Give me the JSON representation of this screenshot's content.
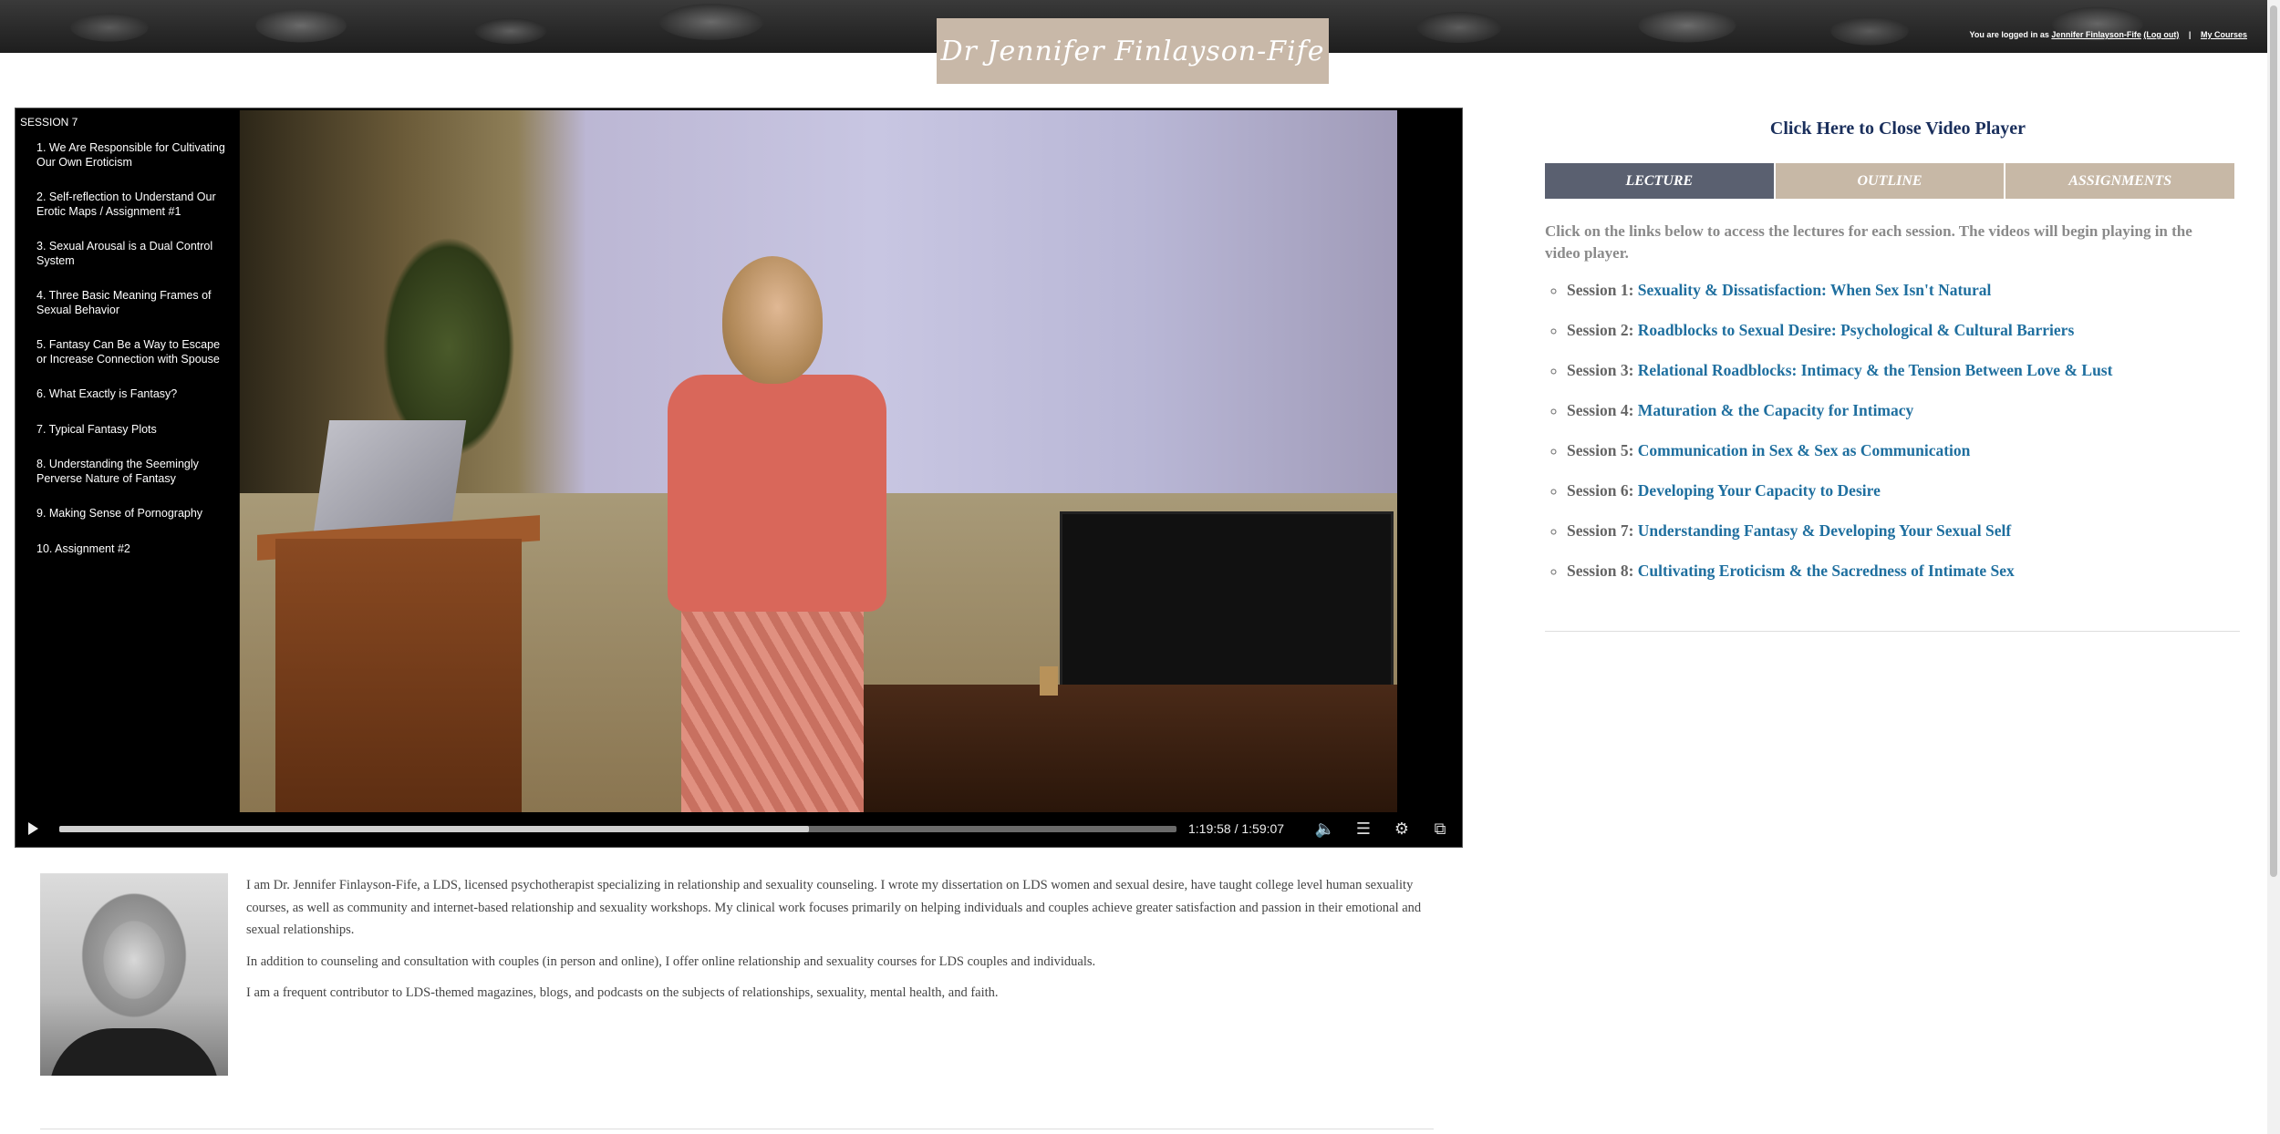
{
  "header": {
    "logo_text": "Dr Jennifer Finlayson-Fife",
    "login_prefix": "You are logged in as",
    "user_name": "Jennifer Finlayson-Fife",
    "logout_label": "(Log out)",
    "separator": "|",
    "my_courses_label": "My Courses"
  },
  "player": {
    "session_label": "SESSION 7",
    "chapters": [
      "1. We Are Responsible for Cultivating Our Own Eroticism",
      "2. Self-reflection to Understand Our Erotic Maps / Assignment #1",
      "3. Sexual Arousal is a Dual Control System",
      "4. Three Basic Meaning Frames of Sexual Behavior",
      "5. Fantasy Can Be a Way to Escape or Increase Connection with Spouse",
      "6. What Exactly is Fantasy?",
      "7. Typical Fantasy Plots",
      "8. Understanding the Seemingly Perverse Nature of Fantasy",
      "9. Making Sense of Pornography",
      "10. Assignment #2"
    ],
    "time_display": "1:19:58 / 1:59:07",
    "progress_fraction": 0.671
  },
  "bio": {
    "paragraphs": [
      "I am Dr. Jennifer Finlayson-Fife, a LDS, licensed psychotherapist specializing in relationship and sexuality counseling. I wrote my dissertation on LDS women and sexual desire, have taught college level human sexuality courses, as well as community and internet-based relationship and sexuality workshops. My clinical work focuses primarily on helping individuals and couples achieve greater satisfaction and passion in their emotional and sexual relationships.",
      "In addition to counseling and consultation with couples (in person and online), I offer online relationship and sexuality courses for LDS couples and individuals.",
      "I am a frequent contributor to LDS-themed magazines, blogs, and podcasts on the subjects of relationships, sexuality, mental health, and faith."
    ]
  },
  "panel": {
    "close_link": "Click Here to Close Video Player",
    "tabs": [
      "LECTURE",
      "OUTLINE",
      "ASSIGNMENTS"
    ],
    "active_tab": "LECTURE",
    "intro": "Click on the links below to access the lectures for each session. The videos will begin playing in the video player.",
    "sessions": [
      {
        "label": "Session 1:",
        "title": "Sexuality & Dissatisfaction: When Sex Isn't Natural"
      },
      {
        "label": "Session 2:",
        "title": "Roadblocks to Sexual Desire: Psychological & Cultural Barriers"
      },
      {
        "label": "Session 3:",
        "title": "Relational Roadblocks: Intimacy & the Tension Between Love & Lust"
      },
      {
        "label": "Session 4:",
        "title": "Maturation & the Capacity for Intimacy"
      },
      {
        "label": "Session 5:",
        "title": "Communication in Sex & Sex as Communication"
      },
      {
        "label": "Session 6:",
        "title": "Developing Your Capacity to Desire"
      },
      {
        "label": "Session 7:",
        "title": "Understanding Fantasy & Developing Your Sexual Self"
      },
      {
        "label": "Session 8:",
        "title": "Cultivating Eroticism & the Sacredness of Intimate Sex"
      }
    ]
  },
  "colors": {
    "accent_link": "#1f6f9f",
    "tab_active": "#5a6070",
    "tab_inactive": "#c7b8a6",
    "logo_bg": "#c8b8a8"
  },
  "icons": {
    "play": "play-icon",
    "volume": "volume-icon",
    "chapters": "chapters-list-icon",
    "settings": "gear-icon",
    "popout": "external-link-icon"
  }
}
